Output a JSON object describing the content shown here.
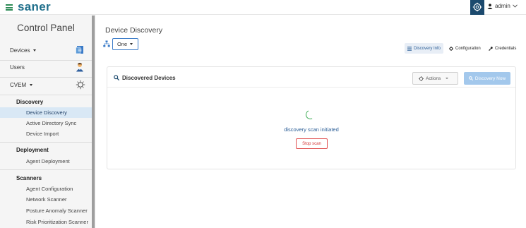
{
  "app": {
    "logo": "saner"
  },
  "header": {
    "user_label": "admin"
  },
  "sidebar": {
    "title": "Control Panel",
    "devices_label": "Devices",
    "users_label": "Users",
    "cvem_label": "CVEM",
    "groups": [
      {
        "title": "Discovery",
        "items": [
          "Device Discovery",
          "Active Directory Sync",
          "Device Import"
        ]
      },
      {
        "title": "Deployment",
        "items": [
          "Agent Deployment"
        ]
      },
      {
        "title": "Scanners",
        "items": [
          "Agent Configuration",
          "Network Scanner",
          "Posture Anomaly Scanner",
          "Risk Prioritization Scanner"
        ]
      }
    ],
    "active_item": "Device Discovery"
  },
  "main": {
    "page_title": "Device Discovery",
    "scope_select": "One",
    "tabs": [
      {
        "label": "Discovery Info",
        "icon": "list-icon",
        "active": true
      },
      {
        "label": "Configuration",
        "icon": "gear-icon",
        "active": false
      },
      {
        "label": "Credentials",
        "icon": "key-icon",
        "active": false
      }
    ],
    "card": {
      "title": "Discovered Devices",
      "actions_label": "Actions",
      "discovery_now_label": "Discovery Now",
      "status_text": "discovery scan initiated",
      "stop_label": "Stop scan"
    }
  },
  "colors": {
    "accent": "#1f6f8b",
    "primary_blue": "#3a7bc8",
    "disabled_blue": "#a3c8ec",
    "danger": "#d43a3a",
    "spinner": "#3cab52",
    "active_bg": "#d9e8f5"
  }
}
